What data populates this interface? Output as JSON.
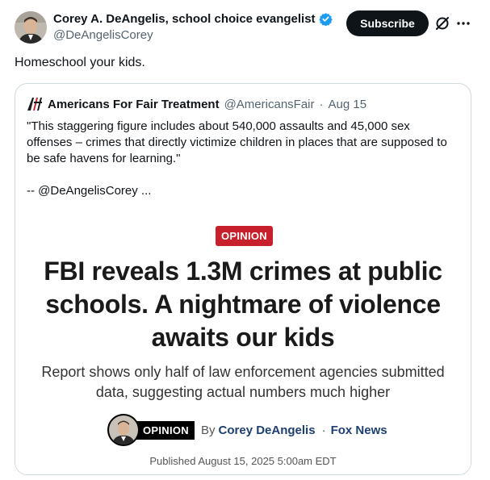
{
  "author": {
    "display_name": "Corey A. DeAngelis, school choice evangelist",
    "handle": "@DeAngelisCorey",
    "verified_icon": "verified-badge-icon",
    "avatar_icon": "avatar"
  },
  "actions": {
    "subscribe_label": "Subscribe",
    "grok_icon": "grok-icon",
    "more_icon": "more-icon"
  },
  "post": {
    "text": "Homeschool your kids."
  },
  "quote": {
    "logo_icon": "aft-logo-icon",
    "name": "Americans For Fair Treatment",
    "handle": "@AmericansFair",
    "separator": "·",
    "date": "Aug 15",
    "text": "\"This staggering figure includes about 540,000 assaults and 45,000 sex offenses – crimes that directly victimize children in places that are supposed to be safe havens for learning.\"",
    "signature": "-- @DeAngelisCorey ..."
  },
  "article": {
    "badge": "OPINION",
    "headline": "FBI reveals 1.3M crimes at public schools. A nightmare of violence awaits our kids",
    "subhead": "Report shows only half of law enforcement agencies submitted data, suggesting actual numbers much higher",
    "byline_badge": "OPINION",
    "by": "By",
    "byline_author": "Corey DeAngelis",
    "byline_sep": "·",
    "outlet": "Fox News",
    "published": "Published August 15, 2025 5:00am EDT"
  },
  "colors": {
    "verified": "#1d9bf0",
    "opinion_red": "#c8202b",
    "byline_blue": "#1d3f72",
    "subscribe_bg": "#0f1419"
  }
}
